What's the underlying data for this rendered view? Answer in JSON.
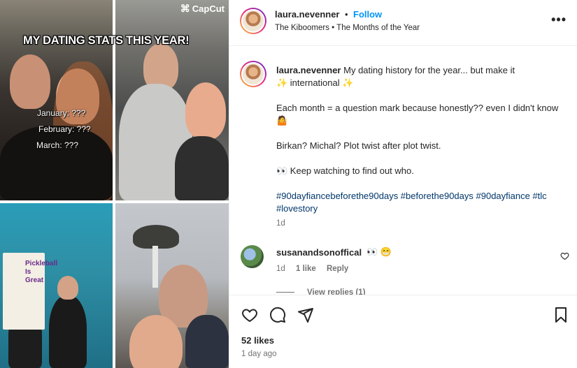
{
  "media": {
    "watermark": "CapCut",
    "overlay_title": "MY DATING STATS THIS YEAR!",
    "months": [
      "January: ???",
      "February: ???",
      "March: ???"
    ],
    "sign_lines": [
      "Pickleball",
      "Is",
      "Great"
    ]
  },
  "header": {
    "username": "laura.nevenner",
    "separator": "•",
    "follow_label": "Follow",
    "audio_line": "The Kiboomers • The Months of the Year",
    "more_label": "•••"
  },
  "caption": {
    "username": "laura.nevenner",
    "line1": "My dating history for the year... but make it",
    "line1b": "✨ international ✨",
    "paragraph2": "Each month = a question mark because honestly?? even I didn't know 🤷",
    "paragraph3": "Birkan? Michal? Plot twist after plot twist.",
    "paragraph4": "👀  Keep watching to find out who.",
    "hashtags": "#90dayfiancebeforethe90days #beforethe90days #90dayfiance #tlc #lovestory",
    "time": "1d"
  },
  "comment": {
    "username": "susanandsonoffical",
    "emoji": "👀 😁",
    "time": "1d",
    "likes": "1 like",
    "reply_label": "Reply",
    "view_replies": "View replies (1)"
  },
  "footer": {
    "likes": "52 likes",
    "posted": "1 day ago"
  },
  "icons": [
    "heart-icon",
    "comment-icon",
    "share-icon",
    "bookmark-icon",
    "more-icon"
  ],
  "colors": {
    "accent": "#0095f6",
    "hashtag": "#00376b",
    "muted": "#737373",
    "text": "#262626"
  }
}
